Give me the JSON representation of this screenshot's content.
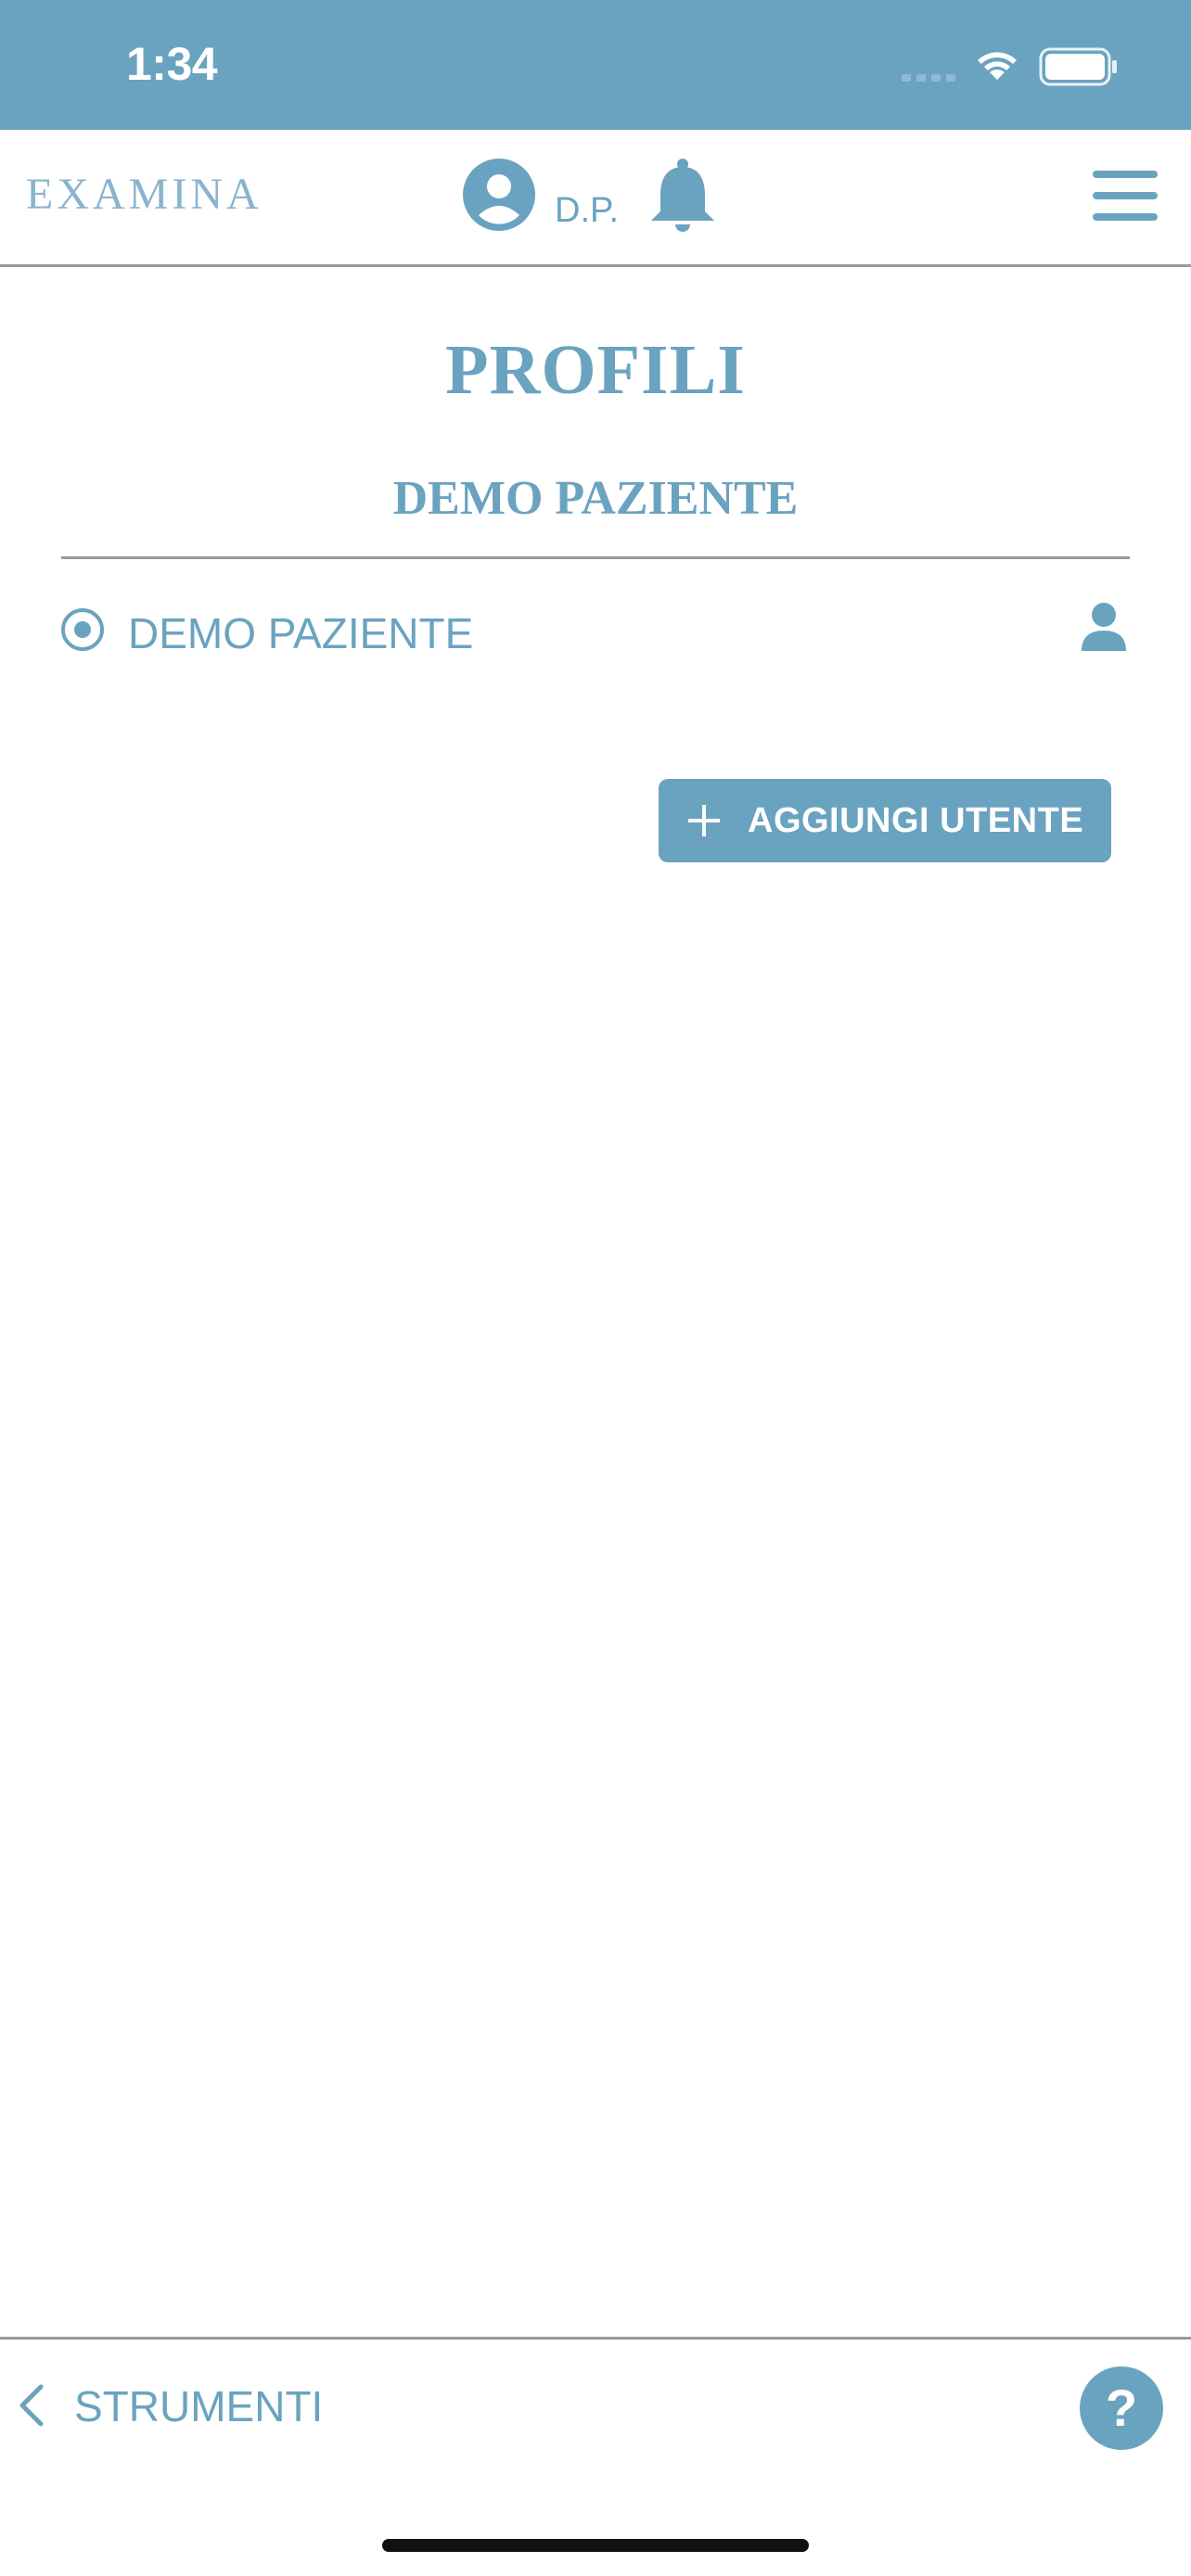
{
  "status_bar": {
    "time": "1:34",
    "icons": [
      "cellular-signal-icon",
      "wifi-icon",
      "battery-icon"
    ]
  },
  "header": {
    "logo": "EXAMINA",
    "user_initials": "D.P.",
    "icons": [
      "avatar-icon",
      "bell-icon",
      "hamburger-menu-icon"
    ]
  },
  "main": {
    "title": "PROFILI",
    "subtitle": "DEMO PAZIENTE",
    "profiles": [
      {
        "name": "DEMO PAZIENTE",
        "selected": true
      }
    ],
    "add_user_label": "AGGIUNGI UTENTE"
  },
  "footer": {
    "back_label": "STRUMENTI",
    "help_label": "?"
  },
  "colors": {
    "accent": "#6aa3c0",
    "logo": "#8ab4cc",
    "divider": "#9a9a9a",
    "background": "#ffffff"
  }
}
